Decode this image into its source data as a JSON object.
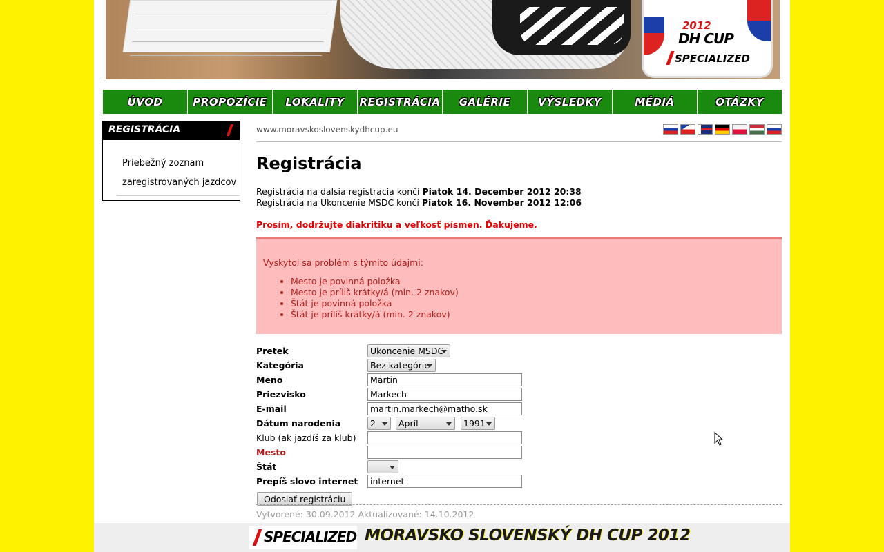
{
  "banner": {
    "logo_year": "2012",
    "logo_title": "DH CUP",
    "logo_brand": "SPECIALIZED"
  },
  "nav": [
    "Úvod",
    "Propozície",
    "Lokality",
    "Registrácia",
    "Galérie",
    "Výsledky",
    "Médiá",
    "Otázky"
  ],
  "sidebar": {
    "heading": "Registrácia",
    "link": "Priebežný zoznam zaregistrovaných jazdcov"
  },
  "content": {
    "site_url": "www.moravskoslovenskydhcup.eu",
    "flags": [
      "slovak-flag-icon",
      "czech-flag-icon",
      "uk-flag-icon",
      "german-flag-icon",
      "polish-flag-icon",
      "hungarian-flag-icon",
      "russian-flag-icon"
    ],
    "title": "Registrácia",
    "deadline1_prefix": "Registrácia na dalsia registracia končí",
    "deadline1_date": "Piatok 14. December 2012 20:38",
    "deadline2_prefix": "Registrácia na Ukoncenie MSDC končí",
    "deadline2_date": "Piatok 16. November 2012 12:06",
    "warning": "Prosím, dodržujte diakritiku a veľkosť písmen. Ďakujeme.",
    "errors_intro": "Vyskytol sa problém s týmito údajmi:",
    "errors": [
      "Mesto je povinná položka",
      "Mesto je príliš krátky/á (min. 2 znakov)",
      "Štát je povinná položka",
      "Štát je príliš krátky/á (min. 2 znakov)"
    ]
  },
  "form": {
    "pretek_label": "Pretek",
    "pretek_value": "Ukoncenie MSDC",
    "kategoria_label": "Kategória",
    "kategoria_value": "Bez kategórie",
    "meno_label": "Meno",
    "meno_value": "Martin",
    "priezvisko_label": "Priezvisko",
    "priezvisko_value": "Markech",
    "email_label": "E-mail",
    "email_value": "martin.markech@matho.sk",
    "datum_label": "Dátum narodenia",
    "datum_day": "2",
    "datum_month": "Apríl",
    "datum_year": "1991",
    "klub_label": "Klub (ak jazdíš za klub)",
    "klub_value": "",
    "mesto_label": "Mesto",
    "mesto_value": "",
    "stat_label": "Štát",
    "stat_value": "",
    "captcha_label": "Prepíš slovo internet",
    "captcha_value": "internet",
    "submit_label": "Odoslať registráciu"
  },
  "meta": "Vytvorené: 30.09.2012 Aktualizované: 14.10.2012",
  "footer": {
    "brand": "SPECIALIZED",
    "title": "Moravsko Slovenský DH Cup 2012"
  },
  "colors": {
    "page_background": "#fff200",
    "nav_green": "#1a8a0e",
    "error_background": "#ffbcbc",
    "error_text": "#b01c1c",
    "warning_red": "#e00000"
  }
}
